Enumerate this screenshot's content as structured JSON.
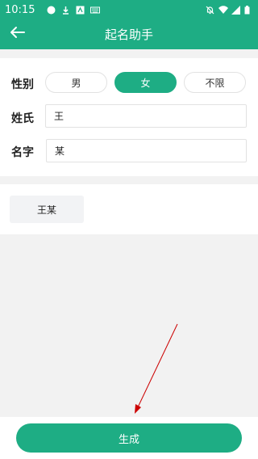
{
  "status_bar": {
    "time": "10:15",
    "left_icons": [
      "circle-icon",
      "download-icon",
      "app-icon",
      "keyboard-icon"
    ],
    "right_icons": [
      "bell-off-icon",
      "wifi-icon",
      "signal-icon",
      "battery-icon"
    ]
  },
  "app_bar": {
    "title": "起名助手",
    "back_icon": "arrow-left-icon",
    "color": "#1ead84"
  },
  "form": {
    "gender_label": "性别",
    "gender_options": [
      "男",
      "女",
      "不限"
    ],
    "gender_selected": "女",
    "surname_label": "姓氏",
    "surname_value": "王",
    "name_label": "名字",
    "name_value": "某"
  },
  "results": [
    "王某"
  ],
  "generate_button": "生成",
  "colors": {
    "accent": "#1ead84",
    "background": "#f2f2f2",
    "annotation_arrow": "#cc0000"
  }
}
